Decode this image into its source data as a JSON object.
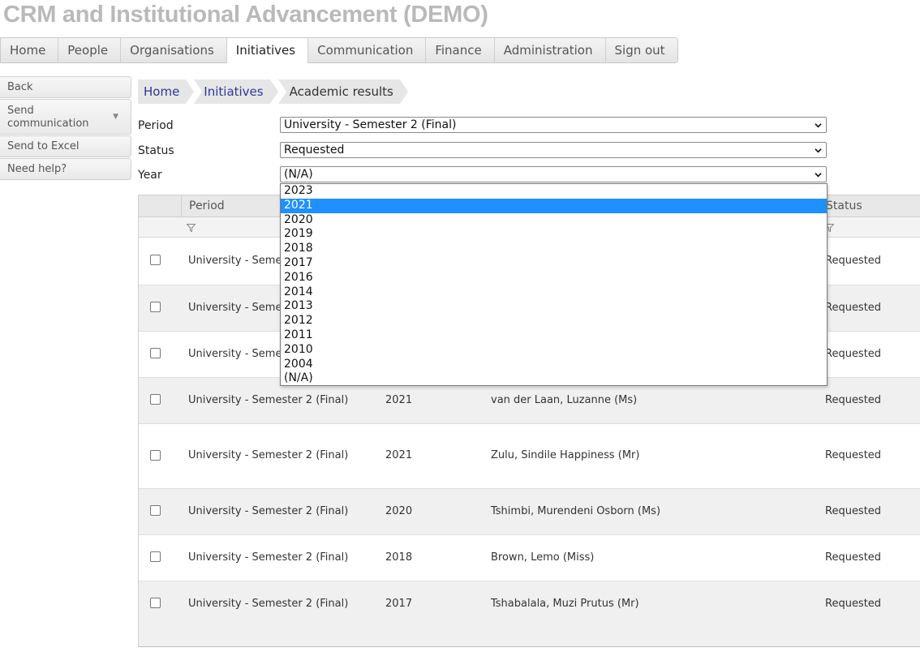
{
  "app": {
    "title": "CRM and Institutional Advancement (DEMO)"
  },
  "nav": {
    "tabs": [
      {
        "label": "Home"
      },
      {
        "label": "People"
      },
      {
        "label": "Organisations"
      },
      {
        "label": "Initiatives",
        "active": true
      },
      {
        "label": "Communication"
      },
      {
        "label": "Finance"
      },
      {
        "label": "Administration"
      },
      {
        "label": "Sign out"
      }
    ]
  },
  "sidebar": {
    "back": "Back",
    "send_communication": "Send communication",
    "send_to_excel": "Send to Excel",
    "need_help": "Need help?"
  },
  "breadcrumb": {
    "items": [
      "Home",
      "Initiatives",
      "Academic results"
    ]
  },
  "filters": {
    "period": {
      "label": "Period",
      "value": "University - Semester 2 (Final)"
    },
    "status": {
      "label": "Status",
      "value": "Requested"
    },
    "year": {
      "label": "Year",
      "value": "(N/A)",
      "highlighted": "2021",
      "options": [
        "2023",
        "2021",
        "2020",
        "2019",
        "2018",
        "2017",
        "2016",
        "2014",
        "2013",
        "2012",
        "2011",
        "2010",
        "2004",
        "(N/A)"
      ]
    }
  },
  "grid": {
    "columns": {
      "period": "Period",
      "status": "Status"
    },
    "rows": [
      {
        "period": "University - Semester 2 (Final)",
        "year": "",
        "name": "",
        "status": "Requested"
      },
      {
        "period": "University - Semester 2 (Final)",
        "year": "",
        "name": "",
        "status": "Requested"
      },
      {
        "period": "University - Semester 2 (Final)",
        "year": "",
        "name": "",
        "status": "Requested"
      },
      {
        "period": "University - Semester 2 (Final)",
        "year": "2021",
        "name": "van der Laan, Luzanne (Ms)",
        "status": "Requested"
      },
      {
        "period": "University - Semester 2 (Final)",
        "year": "2021",
        "name": "Zulu, Sindile Happiness (Mr)",
        "status": "Requested"
      },
      {
        "period": "University - Semester 2 (Final)",
        "year": "2020",
        "name": "Tshimbi, Murendeni Osborn (Ms)",
        "status": "Requested"
      },
      {
        "period": "University - Semester 2 (Final)",
        "year": "2018",
        "name": "Brown, Lemo (Miss)",
        "status": "Requested"
      },
      {
        "period": "University - Semester 2 (Final)",
        "year": "2017",
        "name": "Tshabalala, Muzi Prutus (Mr)",
        "status": "Requested"
      }
    ]
  },
  "colors": {
    "highlight": "#1e90ff",
    "link": "#2b3a9a",
    "title": "#b9b9b9"
  }
}
